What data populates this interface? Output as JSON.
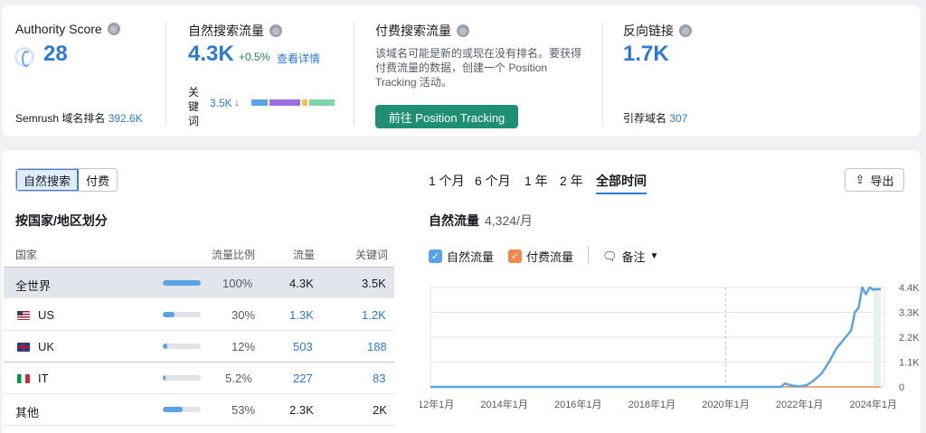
{
  "authority": {
    "title": "Authority Score",
    "value": "28",
    "rank_label": "Semrush 域名排名",
    "rank_value": "392.6K"
  },
  "organic": {
    "title": "自然搜索流量",
    "value": "4.3K",
    "delta": "+0.5%",
    "details_link": "查看详情",
    "keywords_label": "关键词",
    "keywords_value": "3.5K",
    "keywords_trend": "↓"
  },
  "paid": {
    "title": "付费搜索流量",
    "description": "该域名可能是新的或现在没有排名。要获得付费流量的数据，创建一个 Position Tracking 活动。",
    "button": "前往 Position Tracking"
  },
  "backlinks": {
    "title": "反向链接",
    "value": "1.7K",
    "ref_label": "引荐域名",
    "ref_value": "307"
  },
  "toggle": {
    "organic": "自然搜索",
    "paid": "付费"
  },
  "country_section": {
    "title": "按国家/地区划分"
  },
  "table": {
    "headers": {
      "country": "国家",
      "share": "流量比例",
      "traffic": "流量",
      "keywords": "关键词"
    },
    "rows": [
      {
        "country": "全世界",
        "share": "100%",
        "traffic": "4.3K",
        "keywords": "3.5K"
      },
      {
        "country": "US",
        "share": "30%",
        "traffic": "1.3K",
        "keywords": "1.2K"
      },
      {
        "country": "UK",
        "share": "12%",
        "traffic": "503",
        "keywords": "188"
      },
      {
        "country": "IT",
        "share": "5.2%",
        "traffic": "227",
        "keywords": "83"
      },
      {
        "country": "其他",
        "share": "53%",
        "traffic": "2.3K",
        "keywords": "2K"
      }
    ]
  },
  "periods": [
    "1 个月",
    "6 个月",
    "1 年",
    "2 年",
    "全部时间"
  ],
  "export_label": "导出",
  "chart_header": {
    "title": "自然流量",
    "value": "4,324/月"
  },
  "legend": {
    "organic": "自然流量",
    "paid": "付费流量",
    "notes": "备注"
  },
  "colors": {
    "accent": "#2a7bd3",
    "button_green": "#1e8f72",
    "organic_line": "#5aa3e6",
    "paid_line": "#f08a4b"
  },
  "chart_data": {
    "type": "line",
    "x_tick_labels": [
      "2012年1月",
      "2014年1月",
      "2016年1月",
      "2018年1月",
      "2020年1月",
      "2022年1月",
      "2024年1月"
    ],
    "y_tick_labels": [
      "4.4K",
      "3.3K",
      "2.2K",
      "1.1K",
      "0"
    ],
    "ylim": [
      0,
      4400
    ],
    "xlim": [
      2012.0,
      2024.3
    ],
    "series": [
      {
        "name": "自然流量",
        "x": [
          2012.0,
          2019.0,
          2021.5,
          2021.6,
          2021.8,
          2022.0,
          2022.2,
          2022.4,
          2022.6,
          2022.8,
          2023.0,
          2023.2,
          2023.4,
          2023.5,
          2023.6,
          2023.7,
          2023.8,
          2023.9,
          2024.0,
          2024.1,
          2024.2
        ],
        "y": [
          0,
          0,
          0,
          150,
          60,
          20,
          80,
          300,
          600,
          1100,
          1700,
          2100,
          2500,
          3300,
          3500,
          4400,
          4100,
          4400,
          4300,
          4324,
          4324
        ]
      },
      {
        "name": "付费流量",
        "x": [
          2012.0,
          2024.2
        ],
        "y": [
          0,
          0
        ]
      }
    ]
  }
}
